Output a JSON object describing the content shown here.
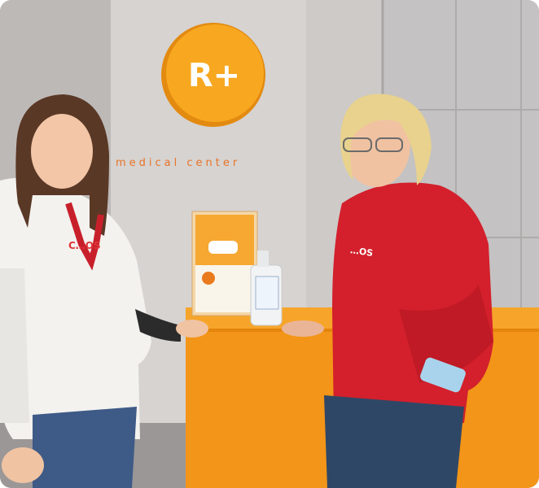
{
  "image": {
    "alt": "Two women posing at the orange reception desk of a medical center",
    "logo": "R+",
    "sign_text": "medical center",
    "left_hoodie_print": "C…OS",
    "right_hoodie_print": "…OS",
    "colors": {
      "wall": "#d2cfcd",
      "logo_orange": "#f6a21c",
      "desk_orange": "#f4931a",
      "red_hoodie": "#d3202c",
      "white_hoodie": "#f3f2ef",
      "brand_text": "#e8742a"
    }
  }
}
